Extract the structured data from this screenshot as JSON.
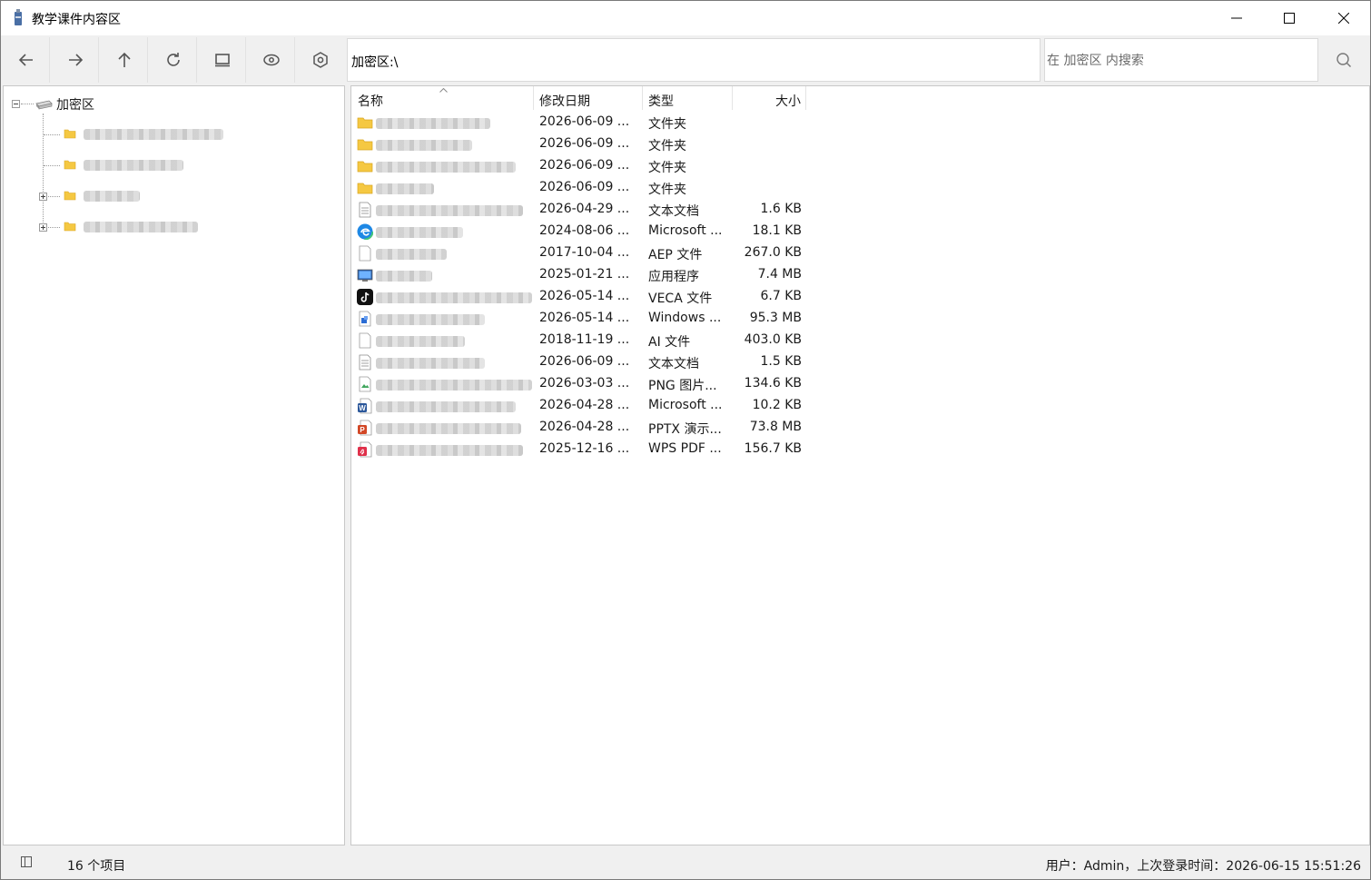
{
  "window": {
    "title": "教学课件内容区"
  },
  "toolbar": {
    "buttons": [
      "back-arrow-icon",
      "forward-arrow-icon",
      "up-arrow-icon",
      "refresh-icon",
      "monitor-icon",
      "eye-icon",
      "settings-icon"
    ]
  },
  "address": {
    "path": "加密区:\\"
  },
  "search": {
    "placeholder": "在 加密区 内搜索"
  },
  "tree": {
    "root_label": "加密区",
    "children": [
      {
        "icon": "folder-icon",
        "expandable": false
      },
      {
        "icon": "folder-icon",
        "expandable": false
      },
      {
        "icon": "folder-icon",
        "expandable": true
      },
      {
        "icon": "folder-icon",
        "expandable": true
      }
    ]
  },
  "list": {
    "columns": {
      "name": "名称",
      "date": "修改日期",
      "type": "类型",
      "size": "大小"
    },
    "rows": [
      {
        "icon": "folder-icon",
        "date": "2026-06-09 ...",
        "type": "文件夹",
        "size": ""
      },
      {
        "icon": "folder-icon",
        "date": "2026-06-09 ...",
        "type": "文件夹",
        "size": ""
      },
      {
        "icon": "folder-icon",
        "date": "2026-06-09 ...",
        "type": "文件夹",
        "size": ""
      },
      {
        "icon": "folder-icon",
        "date": "2026-06-09 ...",
        "type": "文件夹",
        "size": ""
      },
      {
        "icon": "text-file-icon",
        "date": "2026-04-29 ...",
        "type": "文本文档",
        "size": "1.6 KB"
      },
      {
        "icon": "edge-icon",
        "date": "2024-08-06 ...",
        "type": "Microsoft ...",
        "size": "18.1 KB"
      },
      {
        "icon": "blank-file-icon",
        "date": "2017-10-04 ...",
        "type": "AEP 文件",
        "size": "267.0 KB"
      },
      {
        "icon": "application-icon",
        "date": "2025-01-21 ...",
        "type": "应用程序",
        "size": "7.4 MB"
      },
      {
        "icon": "tiktok-icon",
        "date": "2026-05-14 ...",
        "type": "VECA 文件",
        "size": "6.7 KB"
      },
      {
        "icon": "installer-icon",
        "date": "2026-05-14 ...",
        "type": "Windows ...",
        "size": "95.3 MB"
      },
      {
        "icon": "blank-file-icon",
        "date": "2018-11-19 ...",
        "type": "AI 文件",
        "size": "403.0 KB"
      },
      {
        "icon": "text-file-icon",
        "date": "2026-06-09 ...",
        "type": "文本文档",
        "size": "1.5 KB"
      },
      {
        "icon": "image-file-icon",
        "date": "2026-03-03 ...",
        "type": "PNG 图片...",
        "size": "134.6 KB"
      },
      {
        "icon": "word-icon",
        "date": "2026-04-28 ...",
        "type": "Microsoft ...",
        "size": "10.2 KB"
      },
      {
        "icon": "powerpoint-icon",
        "date": "2026-04-28 ...",
        "type": "PPTX 演示...",
        "size": "73.8 MB"
      },
      {
        "icon": "wps-pdf-icon",
        "date": "2025-12-16 ...",
        "type": "WPS PDF ...",
        "size": "156.7 KB"
      }
    ]
  },
  "status": {
    "item_count": "16 个项目",
    "user_info": "用户：Admin，上次登录时间：2026-06-15  15:51:26"
  }
}
